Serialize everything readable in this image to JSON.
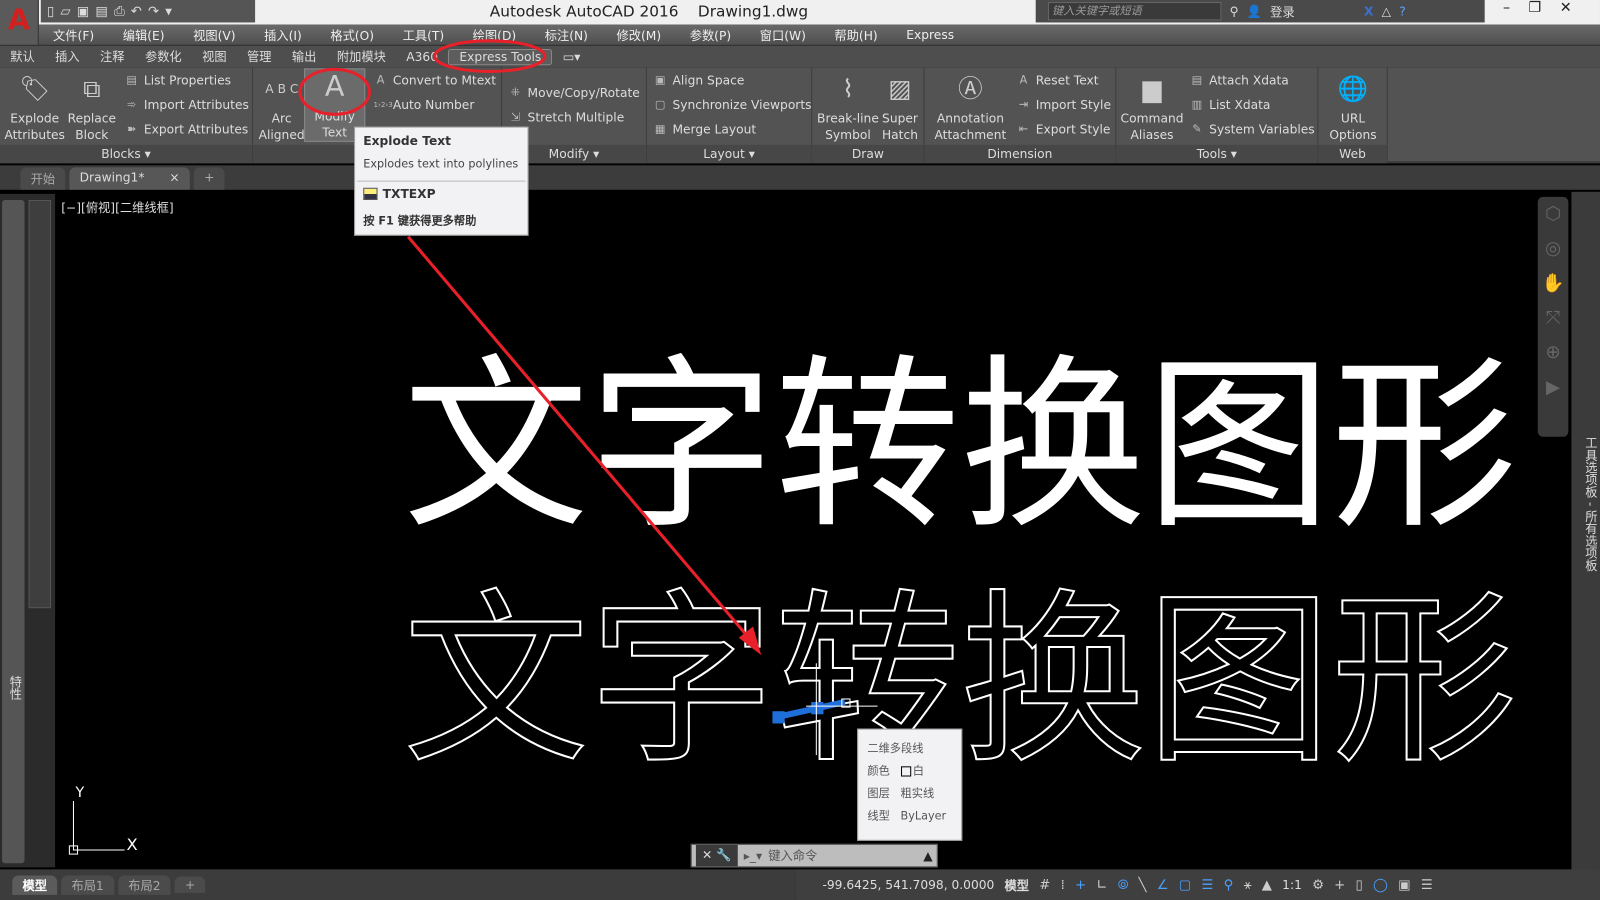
{
  "app": {
    "title": "Autodesk AutoCAD 2016    Drawing1.dwg",
    "logo": "A"
  },
  "search": {
    "placeholder": "键入关键字或短语",
    "login": "登录"
  },
  "menu": [
    "文件(F)",
    "编辑(E)",
    "视图(V)",
    "插入(I)",
    "格式(O)",
    "工具(T)",
    "绘图(D)",
    "标注(N)",
    "修改(M)",
    "参数(P)",
    "窗口(W)",
    "帮助(H)",
    "Express"
  ],
  "ribbon_tabs": [
    "默认",
    "插入",
    "注释",
    "参数化",
    "视图",
    "管理",
    "输出",
    "附加模块",
    "A360",
    "Express Tools"
  ],
  "ribbon_active_tab": "Express Tools",
  "panels": {
    "blocks": {
      "title": "Blocks ▾",
      "explode": "Explode\nAttributes",
      "replace": "Replace\nBlock",
      "items": [
        "List Properties",
        "Import Attributes",
        "Export Attributes"
      ]
    },
    "text": {
      "arc": "Arc\nAligned",
      "modify": "Modify\nText",
      "items": [
        "Convert to Mtext",
        "Auto Number"
      ]
    },
    "modify": {
      "title": "Modify ▾",
      "items": [
        "Move/Copy/Rotate",
        "Stretch Multiple"
      ]
    },
    "layout": {
      "title": "Layout ▾",
      "items": [
        "Align Space",
        "Synchronize Viewports",
        "Merge Layout"
      ]
    },
    "draw": {
      "title": "Draw",
      "breakline": "Break-line\nSymbol",
      "superhatch": "Super\nHatch"
    },
    "dimension": {
      "title": "Dimension",
      "annotation": "Annotation\nAttachment",
      "items": [
        "Reset Text",
        "Import Style",
        "Export Style"
      ]
    },
    "tools": {
      "title": "Tools ▾",
      "aliases": "Command\nAliases",
      "items": [
        "Attach Xdata",
        "List Xdata",
        "System Variables"
      ]
    },
    "web": {
      "title": "Web",
      "url": "URL\nOptions"
    }
  },
  "doc_tabs": [
    "开始",
    "Drawing1*"
  ],
  "viewport_label": "[−][俯视][二维线框]",
  "left_palette_label": "特性",
  "right_palette_label": "工具选项板 - 所有选项板",
  "tooltip": {
    "title": "Explode Text",
    "desc": "Explodes text into polylines",
    "command": "TXTEXP",
    "help": "按 F1 键获得更多帮助"
  },
  "drawing": {
    "solid_text": "文字转换图形",
    "outline_text": "文字转换图形",
    "accent": "#e8202a",
    "grip": "#1e6fd9"
  },
  "quick_props": {
    "type": "二维多段线",
    "rows": [
      {
        "k": "颜色",
        "v": "白"
      },
      {
        "k": "图层",
        "v": "粗实线"
      },
      {
        "k": "线型",
        "v": "ByLayer"
      }
    ]
  },
  "command": {
    "placeholder": "键入命令"
  },
  "ucs": {
    "x": "X",
    "y": "Y"
  },
  "layout_tabs": [
    "模型",
    "布局1",
    "布局2"
  ],
  "status": {
    "coords": "-99.6425, 541.7098, 0.0000",
    "space": "模型",
    "scale": "1:1"
  }
}
